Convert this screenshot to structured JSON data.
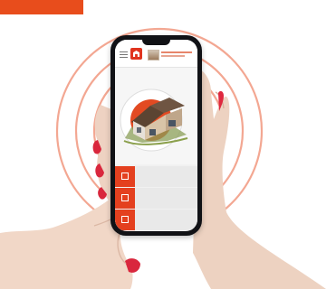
{
  "colors": {
    "accent": "#e84d1c",
    "ring": "#f1a58e",
    "phone": "#111216",
    "screen_bg": "#f1f1f1",
    "tile": "#e4401f"
  },
  "icons": {
    "menu": "hamburger-icon",
    "logo": "house-logo-icon",
    "row": "square-icon"
  },
  "screen": {
    "menu_rows": [
      {
        "label": ""
      },
      {
        "label": ""
      },
      {
        "label": ""
      }
    ]
  }
}
